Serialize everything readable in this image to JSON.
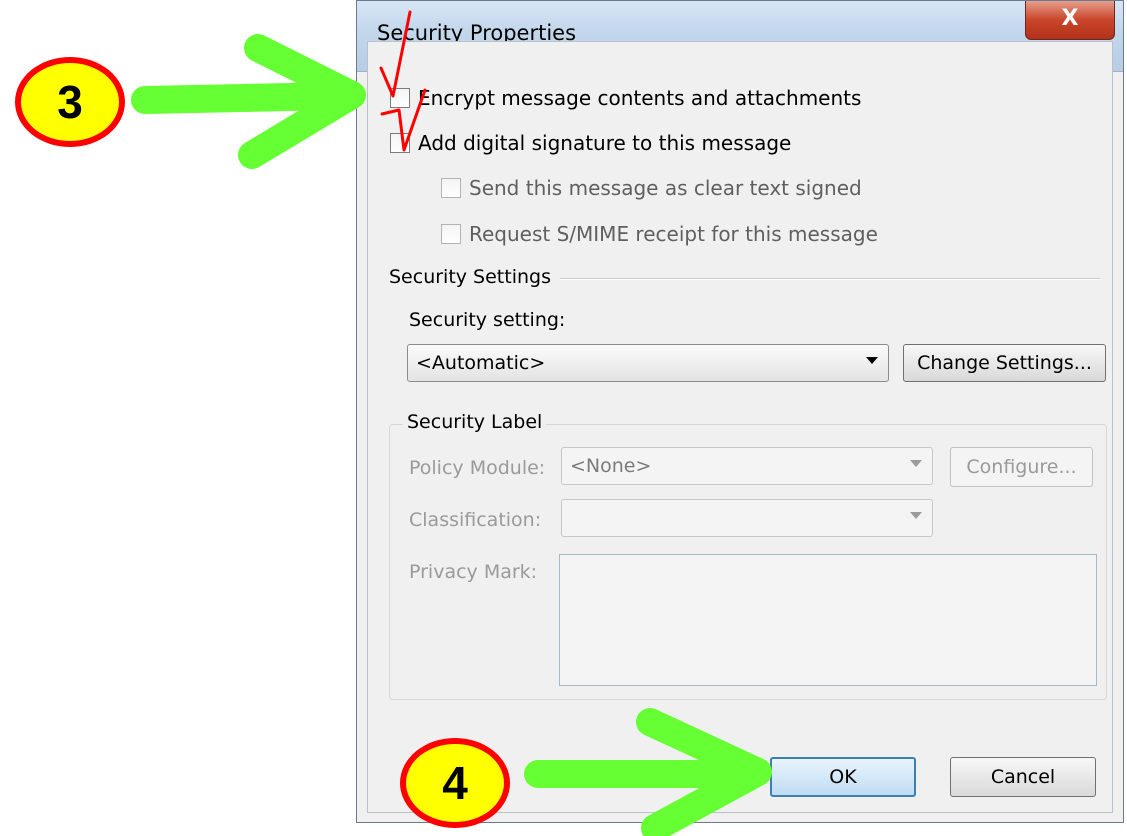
{
  "dialog": {
    "title": "Security Properties",
    "close_label": "X",
    "checkboxes": {
      "encrypt": "Encrypt message contents and attachments",
      "signature": "Add digital signature to this message",
      "clear_text": "Send this message as clear text signed",
      "smime": "Request S/MIME receipt for this message"
    },
    "security_settings": {
      "section_title": "Security Settings",
      "setting_label": "Security setting:",
      "setting_value": "<Automatic>",
      "change_button": "Change Settings..."
    },
    "security_label": {
      "group_title": "Security Label",
      "policy_label": "Policy Module:",
      "policy_value": "<None>",
      "configure_button": "Configure...",
      "classification_label": "Classification:",
      "classification_value": "",
      "privacy_label": "Privacy Mark:"
    },
    "buttons": {
      "ok": "OK",
      "cancel": "Cancel"
    }
  },
  "annotations": {
    "step_3": "3",
    "step_4": "4",
    "arrow_color": "#66ff33",
    "check_color": "#ff0000",
    "badge_fill": "#ffff00",
    "badge_border": "#ff0000"
  }
}
